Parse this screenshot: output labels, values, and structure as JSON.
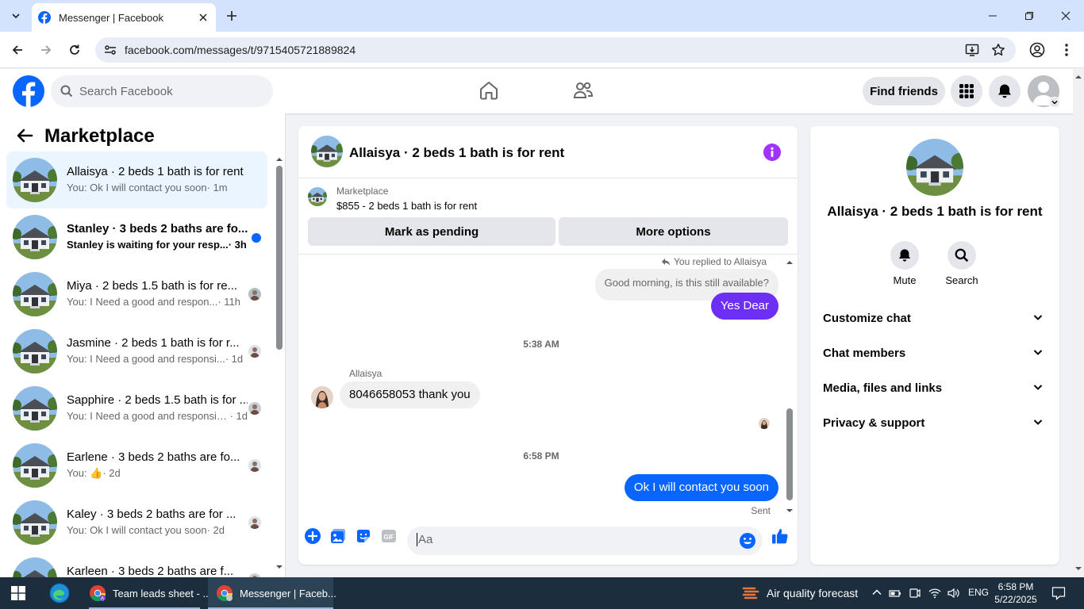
{
  "browser": {
    "tab_title": "Messenger | Facebook",
    "url": "facebook.com/messages/t/9715405721889824"
  },
  "fb_header": {
    "search_placeholder": "Search Facebook",
    "find_friends": "Find friends"
  },
  "left_panel": {
    "title": "Marketplace",
    "conversations": [
      {
        "name": "Allaisya · 2 beds 1 bath is for rent",
        "preview": "You: Ok I will contact you soon",
        "time": "· 1m",
        "active": true,
        "unread": false
      },
      {
        "name": "Stanley · 3 beds 2 baths are fo...",
        "preview": "Stanley is waiting for your resp...",
        "time": " · 3h",
        "active": false,
        "unread": true
      },
      {
        "name": "Miya · 2 beds 1.5 bath is for re...",
        "preview": "You: I Need a good and respon...",
        "time": " · 11h",
        "active": false,
        "unread": false
      },
      {
        "name": "Jasmine · 2 beds 1 bath is for r...",
        "preview": "You: I Need a good and responsi...",
        "time": " · 1d",
        "active": false,
        "unread": false
      },
      {
        "name": "Sapphire · 2 beds 1.5 bath is for ...",
        "preview": "You: I Need a good and responsible...",
        "time": " · 1d",
        "active": false,
        "unread": false
      },
      {
        "name": "Earlene · 3 beds 2 baths are fo...",
        "preview": "You: 👍",
        "time": " · 2d",
        "active": false,
        "unread": false
      },
      {
        "name": "Kaley · 3 beds 2 baths are for ...",
        "preview": "You: Ok I will contact you soon",
        "time": " · 2d",
        "active": false,
        "unread": false
      },
      {
        "name": "Karleen · 3 beds 2 baths are f...",
        "preview": "",
        "time": "",
        "active": false,
        "unread": false
      }
    ]
  },
  "chat": {
    "title": "Allaisya · 2 beds 1 bath is for rent",
    "marketplace_label": "Marketplace",
    "listing": "$855 - 2 beds 1 bath is for rent",
    "mark_pending": "Mark as pending",
    "more_options": "More options",
    "replied_to": "You replied to Allaisya",
    "quoted": "Good morning, is this still available?",
    "reply1": "Yes Dear",
    "time1": "5:38 AM",
    "sender": "Allaisya",
    "incoming": "8046658053 thank you",
    "time2": "6:58 PM",
    "outgoing": "Ok I will contact you soon",
    "status": "Sent",
    "composer_placeholder": "Aa"
  },
  "right_panel": {
    "name": "Allaisya · 2 beds 1 bath is for rent",
    "mute": "Mute",
    "search": "Search",
    "sections": [
      "Customize chat",
      "Chat members",
      "Media, files and links",
      "Privacy & support"
    ]
  },
  "taskbar": {
    "app1": "Team leads sheet - ...",
    "app2": "Messenger | Faceb...",
    "weather": "Air quality forecast",
    "lang": "ENG",
    "time": "6:58 PM",
    "date": "5/22/2025"
  },
  "colors": {
    "fb_blue": "#0866ff",
    "purple": "#6d2ff5",
    "info_purple": "#a033ff"
  }
}
